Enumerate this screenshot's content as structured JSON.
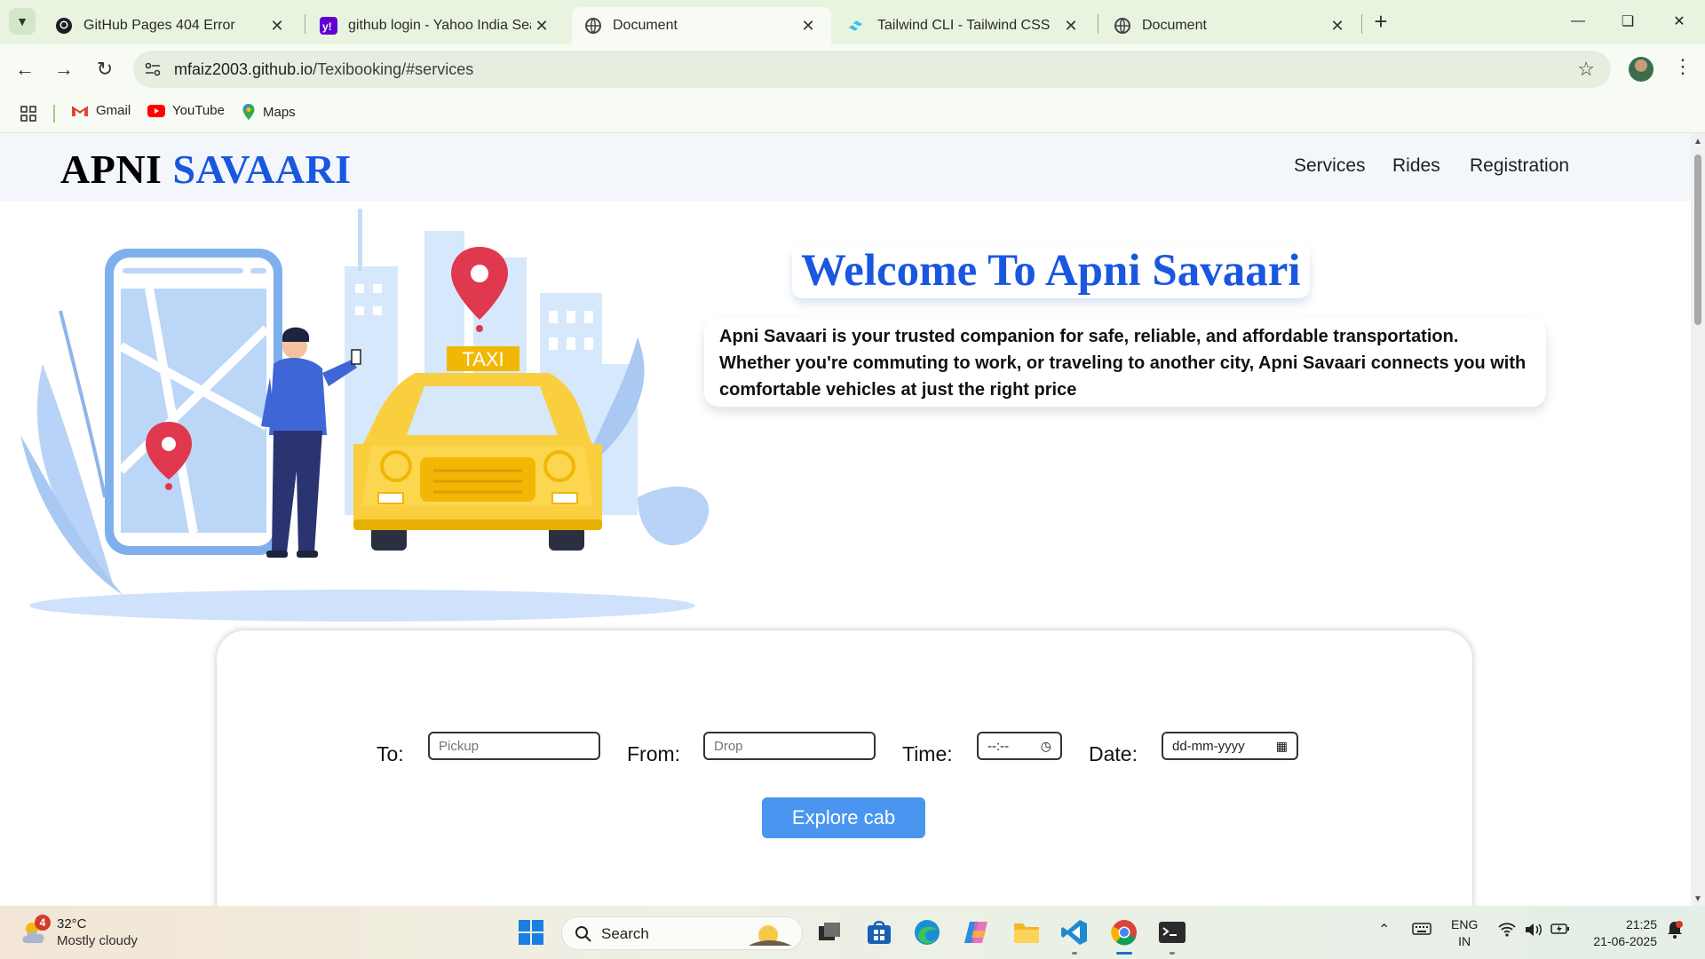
{
  "browser": {
    "tabs": [
      {
        "title": "GitHub Pages 404 Error",
        "icon": "github-icon"
      },
      {
        "title": "github login - Yahoo India Search Results",
        "icon": "yahoo-icon"
      },
      {
        "title": "Document",
        "icon": "globe-icon",
        "active": true
      },
      {
        "title": "Tailwind CLI - Tailwind CSS",
        "icon": "tailwind-icon"
      },
      {
        "title": "Document",
        "icon": "globe-icon"
      }
    ],
    "url_host": "mfaiz2003.github.io",
    "url_path": "/Texibooking/#services",
    "bookmarks": [
      {
        "label": "Gmail",
        "icon": "gmail-icon"
      },
      {
        "label": "YouTube",
        "icon": "youtube-icon"
      },
      {
        "label": "Maps",
        "icon": "maps-icon"
      }
    ]
  },
  "site": {
    "brand_part1": "APNI",
    "brand_part2": "SAVAARI",
    "nav": [
      "Services",
      "Rides",
      "Registration"
    ],
    "welcome": "Welcome To Apni Savaari",
    "about": "Apni Savaari is your trusted companion for safe, reliable, and affordable transportation. Whether you're commuting to work, or traveling to another city, Apni Savaari connects you with comfortable vehicles at just the right price",
    "hero_taxi_sign": "TAXI",
    "form": {
      "to_label": "To:",
      "to_placeholder": "Pickup",
      "from_label": "From:",
      "from_placeholder": "Drop",
      "time_label": "Time:",
      "time_value": "--:--",
      "date_label": "Date:",
      "date_value": "dd-mm-yyyy",
      "submit": "Explore cab"
    },
    "colors": {
      "brand_blue": "#1a57e0",
      "button_blue": "#4a95f0"
    }
  },
  "taskbar": {
    "weather_badge": "4",
    "weather_temp": "32°C",
    "weather_desc": "Mostly cloudy",
    "search_label": "Search",
    "lang_line1": "ENG",
    "lang_line2": "IN",
    "time": "21:25",
    "date": "21-06-2025"
  }
}
